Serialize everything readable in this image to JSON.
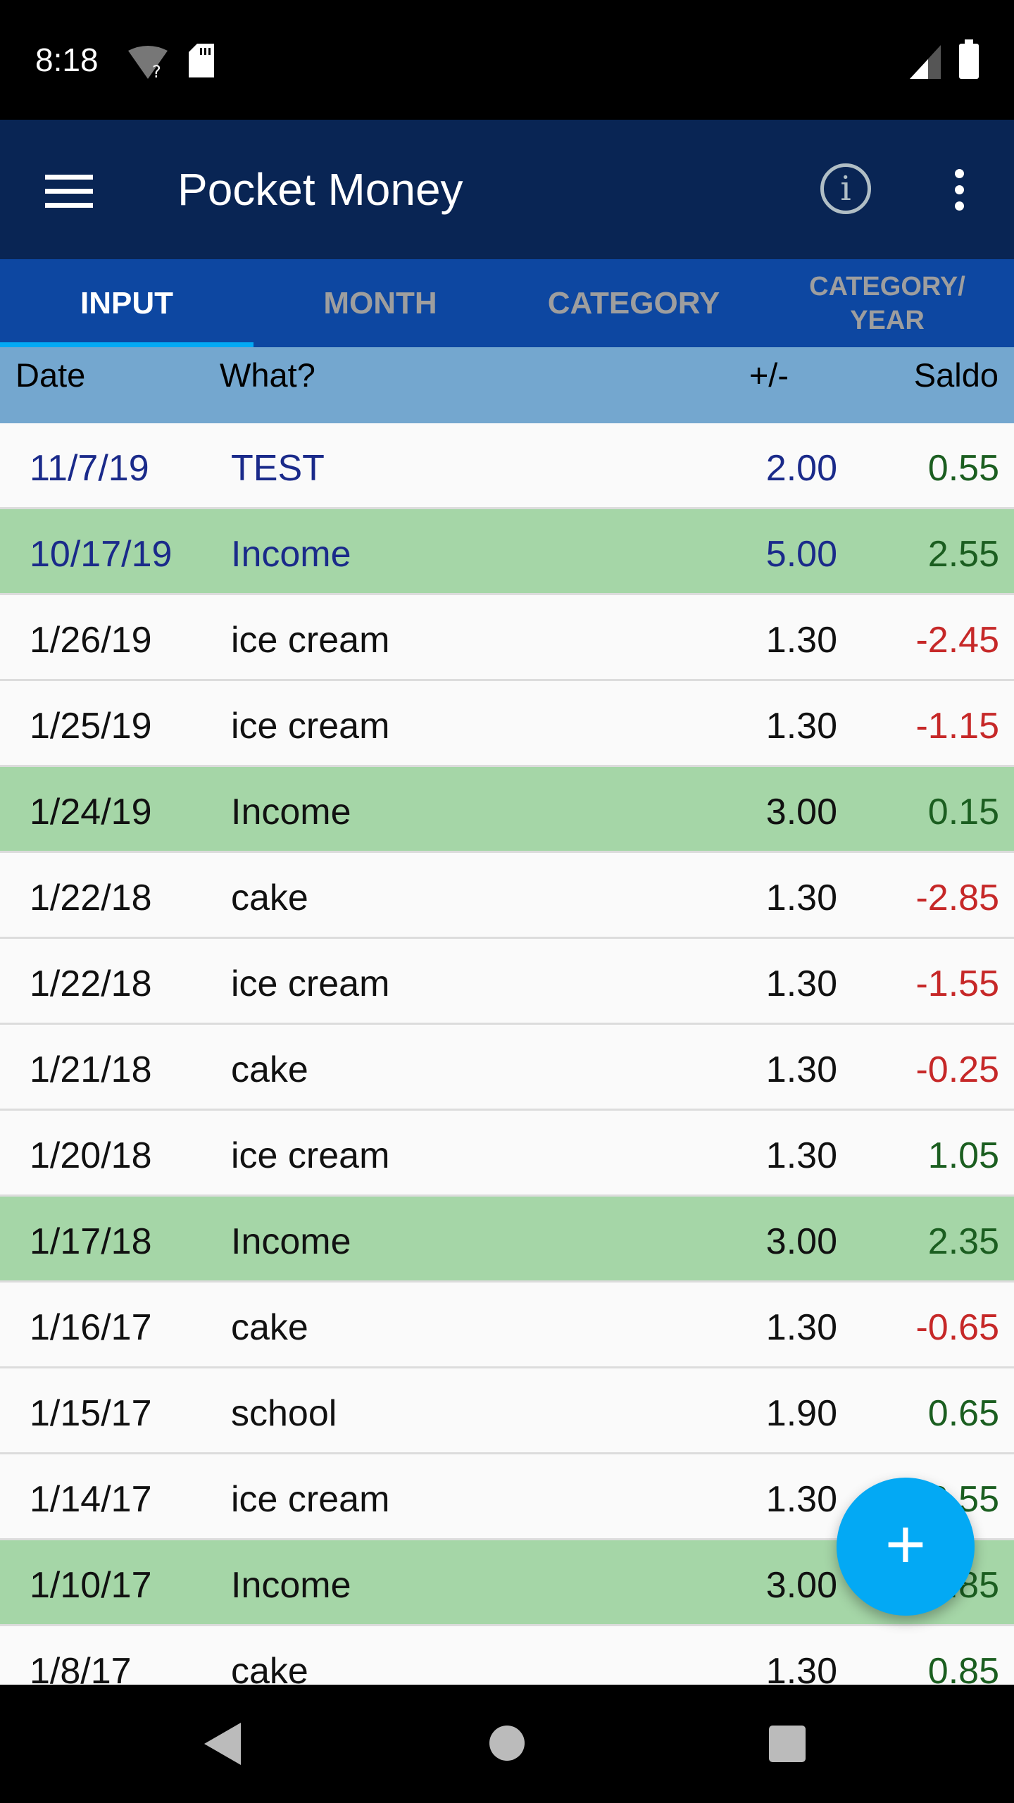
{
  "status_bar": {
    "time": "8:18",
    "icons": [
      "wifi-unknown-icon",
      "sd-card-icon",
      "signal-icon",
      "battery-icon"
    ]
  },
  "app_bar": {
    "title": "Pocket Money",
    "icons": [
      "menu-icon",
      "info-icon",
      "more-vert-icon"
    ]
  },
  "tabs": [
    {
      "label": "INPUT",
      "active": true
    },
    {
      "label": "MONTH"
    },
    {
      "label": "CATEGORY"
    },
    {
      "label": "CATEGORY/ YEAR"
    }
  ],
  "table": {
    "headers": [
      "Date",
      "What?",
      "+/-",
      "Saldo"
    ],
    "rows": [
      {
        "date": "11/7/19",
        "what": "TEST",
        "amount": "2.00",
        "saldo": "0.55",
        "type": "new"
      },
      {
        "date": "10/17/19",
        "what": "Income",
        "amount": "5.00",
        "saldo": "2.55",
        "type": "income-new"
      },
      {
        "date": "1/26/19",
        "what": "ice cream",
        "amount": "1.30",
        "saldo": "-2.45"
      },
      {
        "date": "1/25/19",
        "what": "ice cream",
        "amount": "1.30",
        "saldo": "-1.15"
      },
      {
        "date": "1/24/19",
        "what": "Income",
        "amount": "3.00",
        "saldo": "0.15",
        "type": "income"
      },
      {
        "date": "1/22/18",
        "what": "cake",
        "amount": "1.30",
        "saldo": "-2.85"
      },
      {
        "date": "1/22/18",
        "what": "ice cream",
        "amount": "1.30",
        "saldo": "-1.55"
      },
      {
        "date": "1/21/18",
        "what": "cake",
        "amount": "1.30",
        "saldo": "-0.25"
      },
      {
        "date": "1/20/18",
        "what": "ice cream",
        "amount": "1.30",
        "saldo": "1.05"
      },
      {
        "date": "1/17/18",
        "what": "Income",
        "amount": "3.00",
        "saldo": "2.35",
        "type": "income"
      },
      {
        "date": "1/16/17",
        "what": "cake",
        "amount": "1.30",
        "saldo": "-0.65"
      },
      {
        "date": "1/15/17",
        "what": "school",
        "amount": "1.90",
        "saldo": "0.65"
      },
      {
        "date": "1/14/17",
        "what": "ice cream",
        "amount": "1.30",
        "saldo": "2.55"
      },
      {
        "date": "1/10/17",
        "what": "Income",
        "amount": "3.00",
        "saldo": "3.85",
        "type": "income"
      },
      {
        "date": "1/8/17",
        "what": "cake",
        "amount": "1.30",
        "saldo": "0.85"
      }
    ]
  },
  "fab": {
    "label": "+",
    "icon": "add-icon",
    "color": "#03a9f4"
  },
  "colors": {
    "app_bar": "#092554",
    "tabs": "#0d47a1",
    "header": "#74a7cf",
    "income_row": "#a5d6a7",
    "positive": "#1b5e20",
    "negative": "#c62828"
  }
}
